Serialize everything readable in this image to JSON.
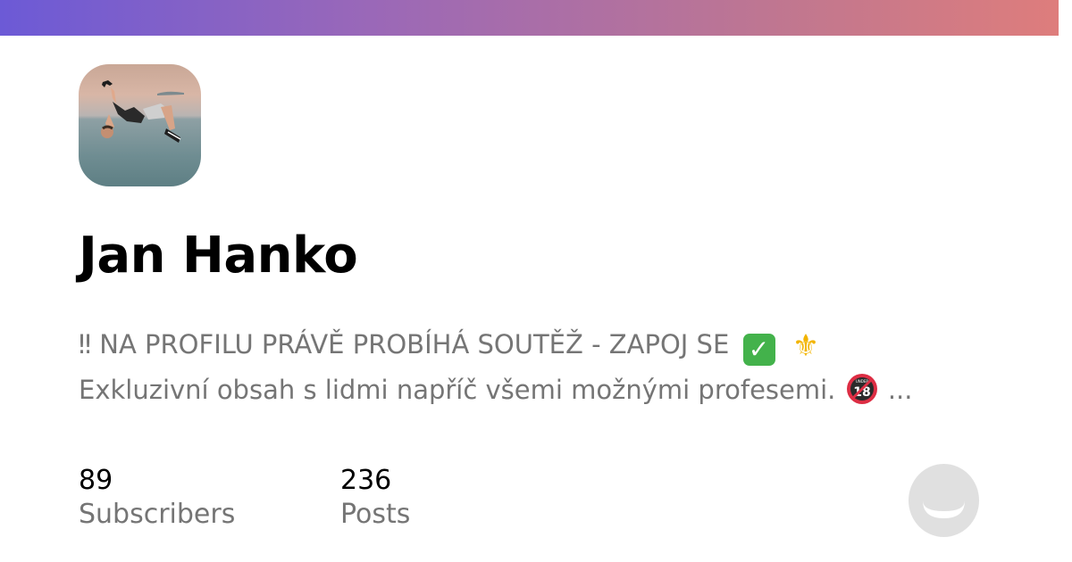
{
  "colors": {
    "gradient_start": "#6c5ad6",
    "gradient_end": "#de7d7c",
    "name_color": "#000000",
    "muted_text": "#757575",
    "logo_gray": "#e0e0e0"
  },
  "profile": {
    "name": "Jan Hanko",
    "avatar_icon": "profile-photo-backflip"
  },
  "bio": {
    "line1": "‼ NA PROFILU PRÁVĚ PROBÍHÁ SOUTĚŽ - ZAPOJ SE",
    "line1_emoji_check": "✓",
    "line1_emoji_fleur": "⚜",
    "line2": "Exkluzivní obsah s lidmi napříč všemi možnými profesemi.",
    "line2_emoji": "under-18-icon",
    "line2_emoji_text": "UNDER",
    "line2_emoji_number": "18",
    "line2_ellipsis": "..."
  },
  "stats": {
    "subscribers_count": "89",
    "subscribers_label": "Subscribers",
    "posts_count": "236",
    "posts_label": "Posts"
  },
  "logo": {
    "icon": "smile-logo-icon"
  }
}
